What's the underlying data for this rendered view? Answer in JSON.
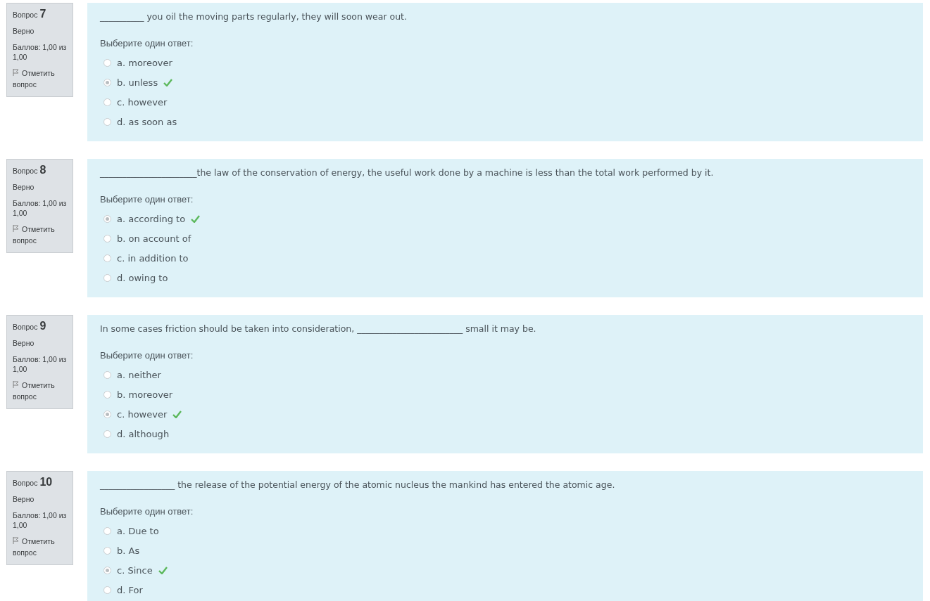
{
  "questions": [
    {
      "label": "Вопрос",
      "number": "7",
      "state": "Верно",
      "grade": "Баллов: 1,00 из 1,00",
      "flag": "Отметить вопрос",
      "text": "__________ you oil the moving parts regularly, they will soon wear out.",
      "prompt": "Выберите один ответ:",
      "options": [
        {
          "text": "a. moreover",
          "selected": false,
          "correct": false
        },
        {
          "text": "b. unless",
          "selected": true,
          "correct": true
        },
        {
          "text": "c. however",
          "selected": false,
          "correct": false
        },
        {
          "text": "d. as soon as",
          "selected": false,
          "correct": false
        }
      ]
    },
    {
      "label": "Вопрос",
      "number": "8",
      "state": "Верно",
      "grade": "Баллов: 1,00 из 1,00",
      "flag": "Отметить вопрос",
      "text": "______________________the law of the conservation of energy, the useful work done by a machine is less than the total work performed by it.",
      "prompt": "Выберите один ответ:",
      "options": [
        {
          "text": "a. according to",
          "selected": true,
          "correct": true
        },
        {
          "text": "b. on account of",
          "selected": false,
          "correct": false
        },
        {
          "text": "c. in addition to",
          "selected": false,
          "correct": false
        },
        {
          "text": "d. owing to",
          "selected": false,
          "correct": false
        }
      ]
    },
    {
      "label": "Вопрос",
      "number": "9",
      "state": "Верно",
      "grade": "Баллов: 1,00 из 1,00",
      "flag": "Отметить вопрос",
      "text": "In some cases friction should be taken into consideration, ________________________ small it may be.",
      "prompt": "Выберите один ответ:",
      "options": [
        {
          "text": "a. neither",
          "selected": false,
          "correct": false
        },
        {
          "text": "b. moreover",
          "selected": false,
          "correct": false
        },
        {
          "text": "c. however",
          "selected": true,
          "correct": true
        },
        {
          "text": "d. although",
          "selected": false,
          "correct": false
        }
      ]
    },
    {
      "label": "Вопрос",
      "number": "10",
      "state": "Верно",
      "grade": "Баллов: 1,00 из 1,00",
      "flag": "Отметить вопрос",
      "text": "_________________ the release of the potential energy of the atomic nucleus the mankind has entered the atomic age.",
      "prompt": "Выберите один ответ:",
      "options": [
        {
          "text": "a. Due to",
          "selected": false,
          "correct": false
        },
        {
          "text": "b. As",
          "selected": false,
          "correct": false
        },
        {
          "text": "c. Since",
          "selected": true,
          "correct": true
        },
        {
          "text": "d. For",
          "selected": false,
          "correct": false
        }
      ]
    }
  ]
}
